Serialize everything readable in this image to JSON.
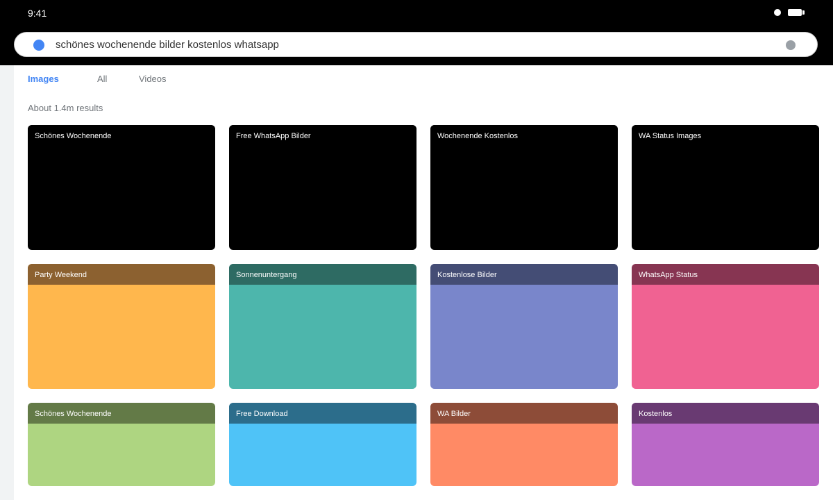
{
  "status_bar": {
    "time": "9:41",
    "icons": [
      "signal-dot-icon",
      "battery-icon"
    ]
  },
  "search": {
    "query": "schönes wochenende bilder kostenlos whatsapp",
    "leading_icon": "search-provider-icon",
    "trailing_icon": "voice-search-icon"
  },
  "tabs": [
    {
      "label": "Images",
      "active": true
    },
    {
      "label": "All",
      "active": false
    },
    {
      "label": "Videos",
      "active": false
    }
  ],
  "results_count": "About 1.4m results",
  "colors": {
    "accent": "#4285f4",
    "topbar": "#000000",
    "rail": "#f1f3f4"
  },
  "tiles": [
    {
      "label": "Schönes Wochenende",
      "color": "#000000",
      "header": "#000000"
    },
    {
      "label": "Free WhatsApp Bilder",
      "color": "#000000",
      "header": "#000000"
    },
    {
      "label": "Wochenende Kostenlos",
      "color": "#000000",
      "header": "#000000"
    },
    {
      "label": "WA Status Images",
      "color": "#000000",
      "header": "#000000"
    },
    {
      "label": "Party Weekend",
      "color": "#ffb74d",
      "header": "#8c6130"
    },
    {
      "label": "Sonnenuntergang",
      "color": "#4db6ac",
      "header": "#2e6b63"
    },
    {
      "label": "Kostenlose Bilder",
      "color": "#7986cb",
      "header": "#444d75"
    },
    {
      "label": "WhatsApp Status",
      "color": "#f06292",
      "header": "#873552"
    },
    {
      "label": "Schönes Wochenende",
      "color": "#aed581",
      "header": "#637a47"
    },
    {
      "label": "Free Download",
      "color": "#4fc3f7",
      "header": "#2c6d8b"
    },
    {
      "label": "WA Bilder",
      "color": "#ff8a65",
      "header": "#8d4c38"
    },
    {
      "label": "Kostenlos",
      "color": "#ba68c8",
      "header": "#693a72"
    }
  ]
}
